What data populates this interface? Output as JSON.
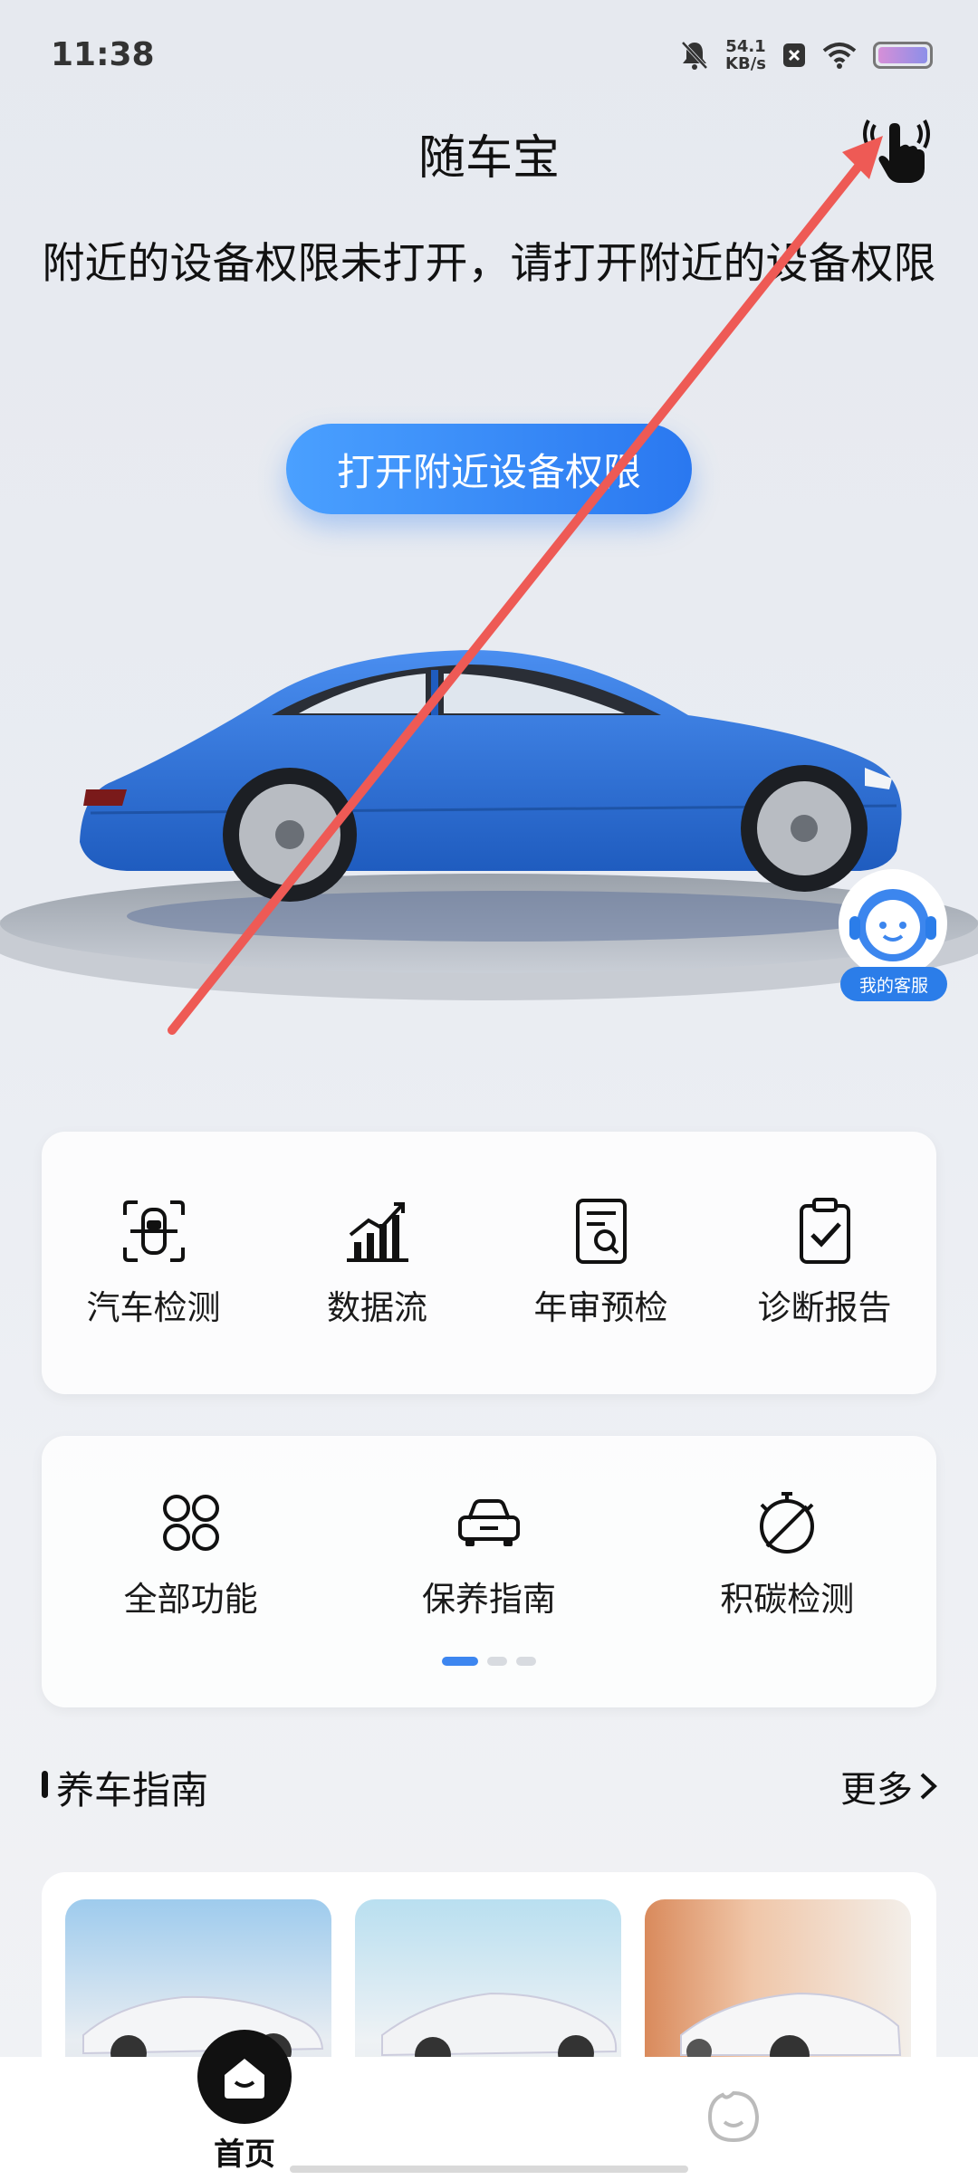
{
  "status_bar": {
    "time": "11:38",
    "speed_value": "54.1",
    "speed_unit": "KB/s",
    "icons": [
      "bell-mute-icon",
      "close-box-icon",
      "wifi-icon",
      "battery-icon"
    ]
  },
  "header": {
    "title": "随车宝",
    "touch_icon": "touch-hand-icon"
  },
  "permission": {
    "message": "附近的设备权限未打开，请打开附近的设备权限",
    "button_label": "打开附近设备权限"
  },
  "support": {
    "label": "我的客服",
    "icon": "headset-avatar-icon"
  },
  "functions_primary": [
    {
      "label": "汽车检测",
      "icon": "car-scan-icon"
    },
    {
      "label": "数据流",
      "icon": "chart-up-icon"
    },
    {
      "label": "年审预检",
      "icon": "document-search-icon"
    },
    {
      "label": "诊断报告",
      "icon": "clipboard-check-icon"
    }
  ],
  "functions_secondary": [
    {
      "label": "全部功能",
      "icon": "grid-four-icon"
    },
    {
      "label": "保养指南",
      "icon": "car-front-icon"
    },
    {
      "label": "积碳检测",
      "icon": "timer-slash-icon"
    }
  ],
  "carousel": {
    "pages": 3,
    "active": 1
  },
  "guide": {
    "title": "养车指南",
    "more": "更多"
  },
  "tabbar": {
    "home_label": "首页",
    "second_icon": "smile-face-icon"
  },
  "colors": {
    "accent": "#2f7ff2",
    "car": "#2f74d8",
    "annotation_arrow": "#ee5a55"
  }
}
